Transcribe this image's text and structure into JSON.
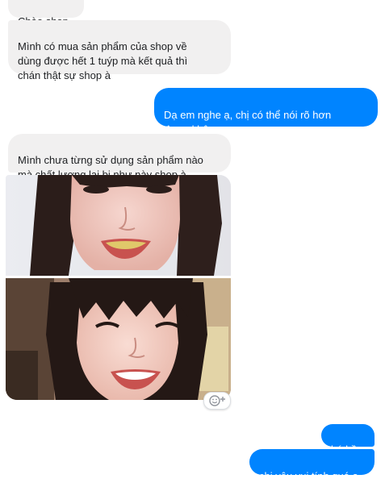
{
  "messages": [
    {
      "id": "m1",
      "sender": "other",
      "text": "Chào shop"
    },
    {
      "id": "m2",
      "sender": "other",
      "text": "Mình có mua sản phẩm của shop về\ndùng được hết 1 tuýp mà kết quả thì\nchán thật sự shop à"
    },
    {
      "id": "m3",
      "sender": "self",
      "text": "Dạ em nghe ạ, chị có thể nói rõ hơn\nđược không ạ"
    },
    {
      "id": "m4",
      "sender": "other",
      "text": "Mình chưa từng sử dụng sản phẩm nào\nmà chất lượng lại bị như này shop à"
    },
    {
      "id": "m5",
      "sender": "other",
      "type": "photos",
      "photos": [
        "selfie-before-yellow-teeth",
        "selfie-after-white-teeth"
      ]
    },
    {
      "id": "m6",
      "sender": "self",
      "text": "hú hồn"
    },
    {
      "id": "m7",
      "sender": "self",
      "text": "chị yêu vui tính quá ạ"
    }
  ],
  "reaction_button": {
    "icon": "smiley-add-icon",
    "glyph": "☺+"
  },
  "colors": {
    "incoming_bubble": "#f1f0f0",
    "outgoing_bubble": "#0084ff",
    "outgoing_text": "#ffffff",
    "incoming_text": "#1c1e21"
  }
}
